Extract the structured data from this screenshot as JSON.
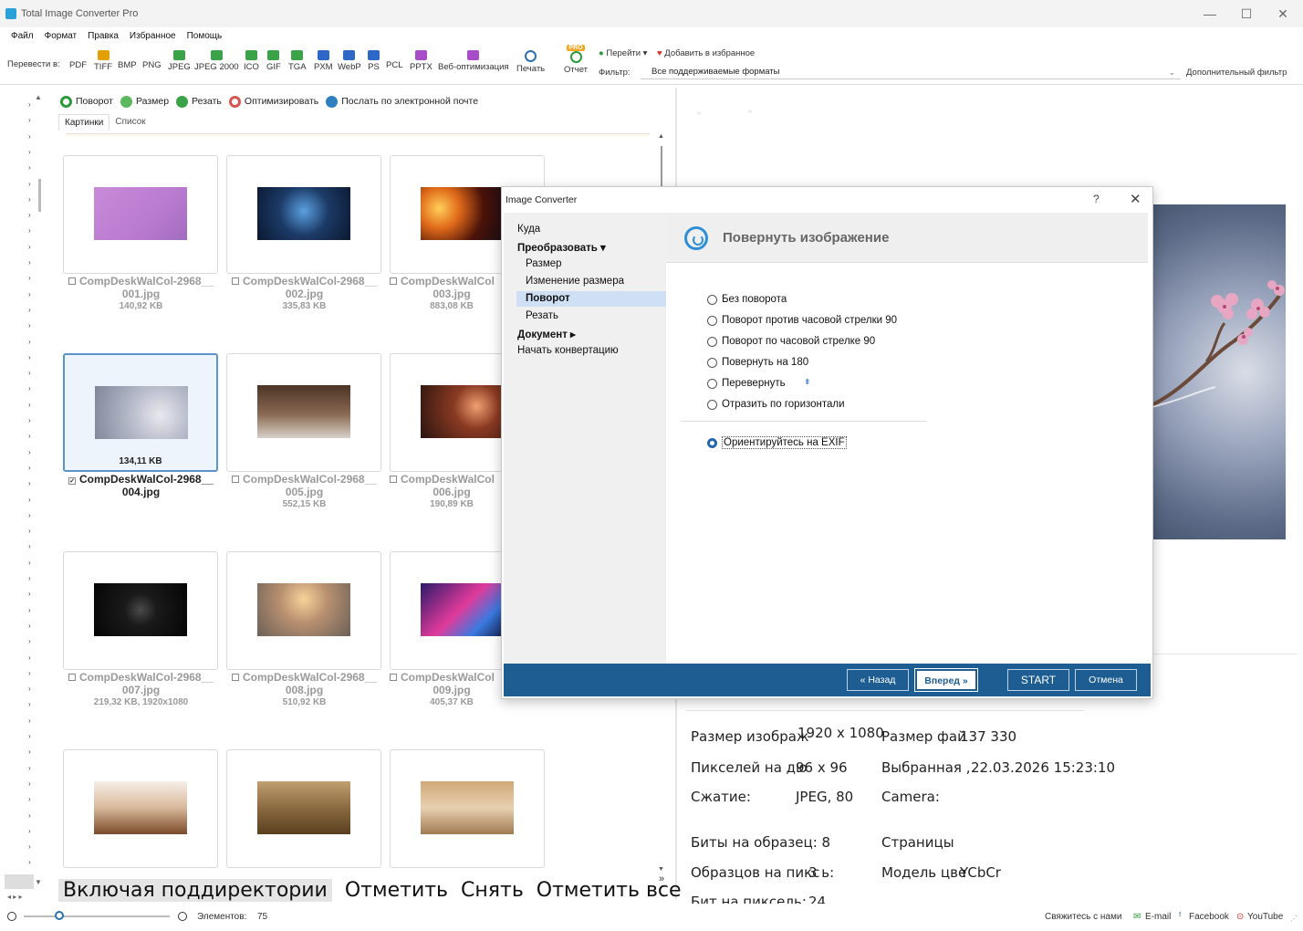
{
  "window": {
    "title": "Total Image Converter Pro",
    "minimize": "—",
    "maximize": "☐",
    "close": "✕"
  },
  "menu": [
    "Файл",
    "Формат",
    "Правка",
    "Избранное",
    "Помощь"
  ],
  "toolbar": {
    "convert_to_label": "Перевести в:",
    "formats": [
      {
        "label": "PDF",
        "color": "#d93025",
        "plain": true
      },
      {
        "label": "TIFF",
        "color": "#e2a100",
        "plain": false
      },
      {
        "label": "BMP",
        "color": "#1f6fc1",
        "plain": true
      },
      {
        "label": "PNG",
        "color": "#1f6fc1",
        "plain": true
      },
      {
        "label": "JPEG",
        "color": "#3aa348",
        "plain": false
      },
      {
        "label": "JPEG 2000",
        "color": "#3aa348",
        "plain": false
      },
      {
        "label": "ICO",
        "color": "#3aa348",
        "plain": false
      },
      {
        "label": "GIF",
        "color": "#3aa348",
        "plain": false
      },
      {
        "label": "TGA",
        "color": "#3aa348",
        "plain": false
      },
      {
        "label": "PXM",
        "color": "#2e68c7",
        "plain": false
      },
      {
        "label": "WebP",
        "color": "#2e68c7",
        "plain": false
      },
      {
        "label": "PS",
        "color": "#2e68c7",
        "plain": false
      },
      {
        "label": "PCL",
        "color": "#555555",
        "plain": true
      },
      {
        "label": "PPTX",
        "color": "#a84cc8",
        "plain": false
      },
      {
        "label": "Веб-оптимизация",
        "color": "#a84cc8",
        "plain": false
      }
    ],
    "print_label": "Печать",
    "report_label": "Отчет",
    "pro_badge": "PRO",
    "goto_label": "Перейти",
    "add_favorites_label": "Добавить в избранное",
    "filter_label": "Фильтр:",
    "filter_value": "Все поддерживаемые форматы",
    "advanced_filter_label": "Дополнительный фильтр"
  },
  "actions": [
    {
      "label": "Поворот",
      "color": "#2a9a3a"
    },
    {
      "label": "Размер",
      "color": "#5cb85c"
    },
    {
      "label": "Резать",
      "color": "#3aa348"
    },
    {
      "label": "Оптимизировать",
      "color": "#d9534f"
    },
    {
      "label": "Послать по электронной почте",
      "color": "#2f7fc1"
    }
  ],
  "view_tabs": [
    "Картинки",
    "Список"
  ],
  "files": [
    {
      "name1": "CompDeskWalCol-2968__",
      "name2": "001.jpg",
      "size": "140,92 KB",
      "selected": false,
      "checked": false,
      "thumb": "linear-gradient(135deg,#c98ad9,#b97bcf 60%,#a26cc0)"
    },
    {
      "name1": "CompDeskWalCol-2968__",
      "name2": "002.jpg",
      "size": "335,83 KB",
      "selected": false,
      "checked": false,
      "thumb": "radial-gradient(circle at 50% 45%,#5aa0e0 0%,#1c3a66 45%,#0b1830 100%)"
    },
    {
      "name1": "CompDeskWalCol",
      "name2": "003.jpg",
      "size": "883,08 KB",
      "selected": false,
      "checked": false,
      "thumb": "radial-gradient(circle at 20% 40%,#ffcf5a 0%,#e06a1a 25%,#4a1208 55%,#0b0b1a 100%)"
    },
    {
      "name1": "CompDeskWalCol-2968__",
      "name2": "004.jpg",
      "size": "134,11 KB",
      "selected": true,
      "checked": true,
      "thumb": "radial-gradient(circle at 70% 55%,#e9e9ee 0%,#b8bccb 40%,#7e8698 100%)"
    },
    {
      "name1": "CompDeskWalCol-2968__",
      "name2": "005.jpg",
      "size": "552,15 KB",
      "selected": false,
      "checked": false,
      "thumb": "linear-gradient(180deg,#4a3326 0%,#8a6a52 55%,#d8d0c8 100%)"
    },
    {
      "name1": "CompDeskWalCol",
      "name2": "006.jpg",
      "size": "190,89 KB",
      "selected": false,
      "checked": false,
      "thumb": "radial-gradient(circle at 60% 40%,#f0a070 0%,#8a3a22 35%,#2a1410 100%)"
    },
    {
      "name1": "CompDeskWalCol-2968__",
      "name2": "007.jpg",
      "size": "219,32 KB, 1920x1080",
      "selected": false,
      "checked": false,
      "thumb": "radial-gradient(circle at 50% 50%,#4a4a4a 0%,#1a1a1a 30%,#050505 100%)"
    },
    {
      "name1": "CompDeskWalCol-2968__",
      "name2": "008.jpg",
      "size": "510,92 KB",
      "selected": false,
      "checked": false,
      "thumb": "radial-gradient(circle at 50% 30%,#f5d39a 0%,#b89070 40%,#6a6058 100%)"
    },
    {
      "name1": "CompDeskWalCol",
      "name2": "009.jpg",
      "size": "405,37 KB",
      "selected": false,
      "checked": false,
      "thumb": "linear-gradient(135deg,#2a1a6a 0%,#e03a9a 45%,#3a7ae0 70%,#0a0a2a 100%)"
    },
    {
      "name1": "",
      "name2": "",
      "size": "",
      "selected": false,
      "checked": false,
      "thumb": "linear-gradient(180deg,#f6efe8 0%,#d8b89a 50%,#7a4a2a 100%)"
    },
    {
      "name1": "",
      "name2": "",
      "size": "",
      "selected": false,
      "checked": false,
      "thumb": "linear-gradient(180deg,#c0a070 0%,#8a6a40 50%,#5a4020 100%)"
    },
    {
      "name1": "",
      "name2": "",
      "size": "",
      "selected": false,
      "checked": false,
      "thumb": "linear-gradient(180deg,#d0a878 0%,#e8d0b0 50%,#a07a50 100%)"
    }
  ],
  "bottom_actions": [
    "Включая поддиректории",
    "Отметить",
    "Снять",
    "Отметить все"
  ],
  "more_chevron": "»",
  "status": {
    "elements_label": "Элементов:",
    "elements_count": "75",
    "contact": "Свяжитесь с нами",
    "email": "E-mail",
    "facebook": "Facebook",
    "youtube": "YouTube"
  },
  "preview_info": {
    "image_size_label": "Размер изображ",
    "image_size_value": "1920 x 1080",
    "file_size_label": "Размер фай",
    "file_size_value": "137 330",
    "ppi_label": "Пикселей на дю",
    "ppi_value": "96 x 96",
    "selected_label": "Выбранная ,",
    "selected_value": "22.03.2026 15:23:10",
    "compression_label": "Сжатие:",
    "compression_value": "JPEG, 80",
    "camera_label": "Camera:",
    "bits_sample_label": "Биты на образец: 8",
    "pages_label": "Страницы",
    "samples_pixel_label": "Образцов на пикс",
    "samples_pixel_value": "3  ь:",
    "color_model_label": "Модель цве",
    "color_model_value": "YCbCr",
    "bits_pixel_label": "Бит на пиксель:",
    "bits_pixel_value": "24"
  },
  "dialog": {
    "title": "Image Converter",
    "help": "?",
    "close": "✕",
    "nav": [
      {
        "label": "Куда",
        "style": "normal"
      },
      {
        "label": "Преобразовать ▾",
        "style": "bold"
      },
      {
        "label": "Размер",
        "style": "sub"
      },
      {
        "label": "Изменение размера",
        "style": "sub"
      },
      {
        "label": "Поворот",
        "style": "active"
      },
      {
        "label": "Резать",
        "style": "sub"
      },
      {
        "label": "Документ ▸",
        "style": "bold"
      },
      {
        "label": "Начать конвертацию",
        "style": "normal"
      }
    ],
    "heading": "Повернуть изображение",
    "options": [
      {
        "label": "Без поворота",
        "checked": false
      },
      {
        "label": "Поворот против часовой стрелки 90",
        "checked": false
      },
      {
        "label": "Поворот по часовой стрелке 90",
        "checked": false
      },
      {
        "label": "Повернуть на 180",
        "checked": false
      },
      {
        "label": "Перевернуть",
        "checked": false
      },
      {
        "label": "Отразить по горизонтали",
        "checked": false
      }
    ],
    "exif_option": {
      "label": "Ориентируйтесь на EXIF",
      "checked": true
    },
    "buttons": {
      "back": "« Назад",
      "next": "Вперед »",
      "start": "START",
      "cancel": "Отмена"
    }
  }
}
